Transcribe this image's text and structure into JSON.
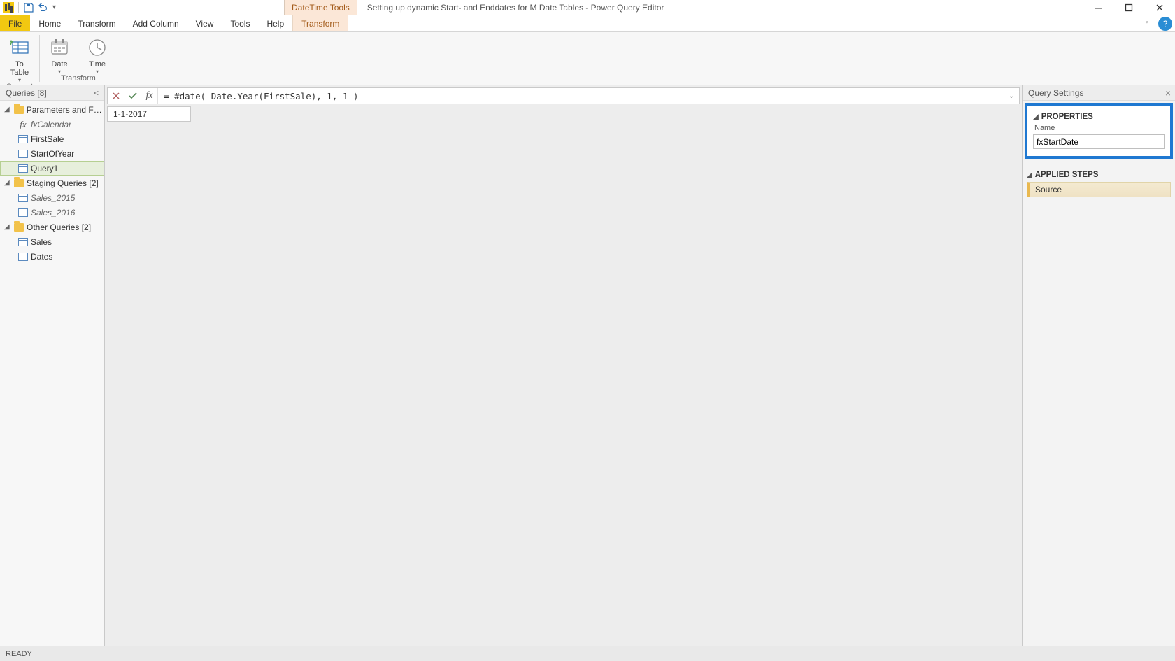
{
  "titlebar": {
    "context_tool_tab": "DateTime Tools",
    "window_title": "Setting up dynamic Start- and Enddates for M Date Tables - Power Query Editor"
  },
  "ribbon": {
    "tabs": {
      "file": "File",
      "home": "Home",
      "transform": "Transform",
      "add_column": "Add Column",
      "view": "View",
      "tools": "Tools",
      "help": "Help",
      "context_transform": "Transform"
    },
    "groups": {
      "convert": {
        "label": "Convert",
        "to_table": "To\nTable"
      },
      "transform": {
        "label": "Transform",
        "date": "Date",
        "time": "Time"
      }
    }
  },
  "queries_pane": {
    "header": "Queries [8]",
    "folders": [
      {
        "label": "Parameters and Fu...",
        "items": [
          {
            "type": "fx",
            "label": "fxCalendar",
            "italic": true
          },
          {
            "type": "table",
            "label": "FirstSale"
          },
          {
            "type": "table",
            "label": "StartOfYear"
          },
          {
            "type": "table",
            "label": "Query1",
            "selected": true
          }
        ]
      },
      {
        "label": "Staging Queries [2]",
        "items": [
          {
            "type": "table",
            "label": "Sales_2015",
            "italic": true
          },
          {
            "type": "table",
            "label": "Sales_2016",
            "italic": true
          }
        ]
      },
      {
        "label": "Other Queries [2]",
        "items": [
          {
            "type": "table",
            "label": "Sales"
          },
          {
            "type": "table",
            "label": "Dates"
          }
        ]
      }
    ]
  },
  "formula_bar": {
    "formula": "= #date( Date.Year(FirstSale), 1, 1 )"
  },
  "preview": {
    "value": "1-1-2017"
  },
  "settings": {
    "header": "Query Settings",
    "properties_label": "PROPERTIES",
    "name_label": "Name",
    "name_value": "fxStartDate",
    "applied_steps_label": "APPLIED STEPS",
    "steps": [
      "Source"
    ]
  },
  "statusbar": {
    "text": "READY"
  }
}
